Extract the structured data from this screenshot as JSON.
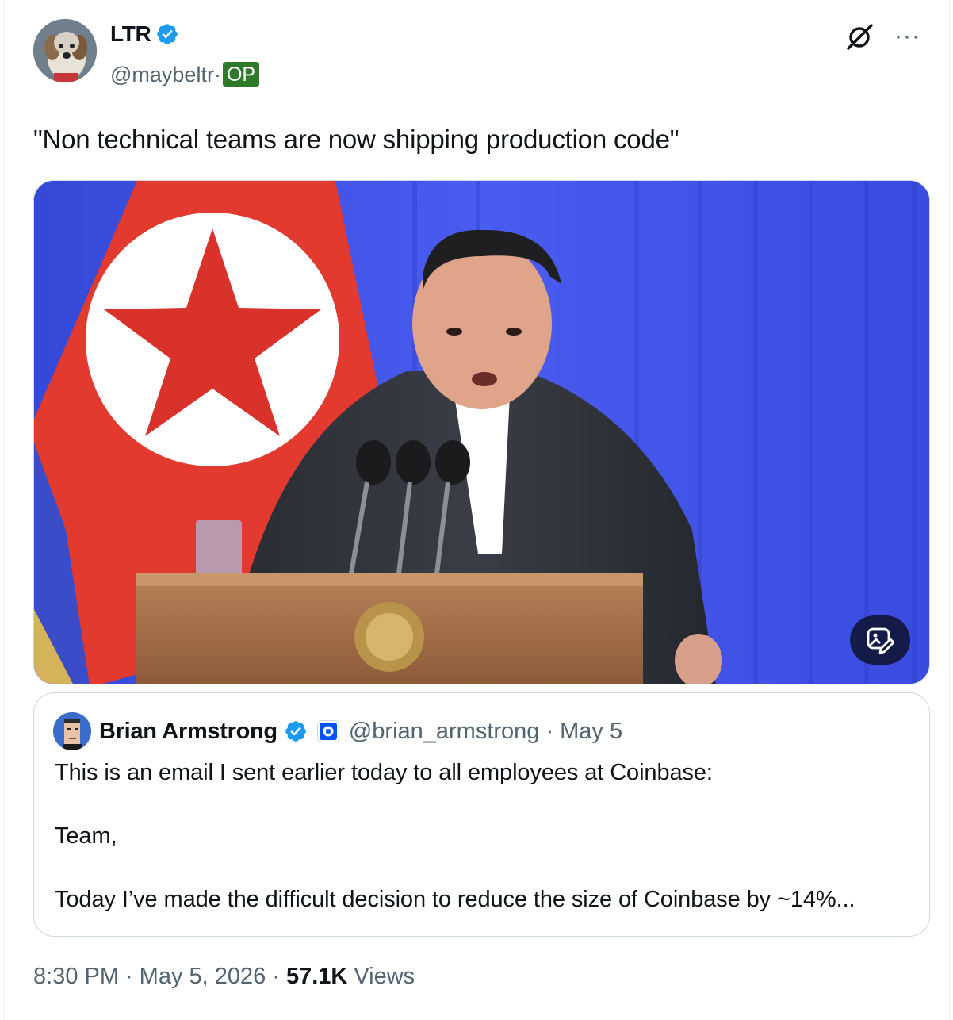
{
  "author": {
    "name": "LTR",
    "handle": "@maybeltr",
    "separator": "·",
    "op_badge": "OP",
    "verified_icon": "verified-badge-icon",
    "avatar_icon": "dog-avatar"
  },
  "actions": {
    "grok_icon": "grok-icon",
    "more_label": "···"
  },
  "tweet": {
    "text": "\"Non technical teams are now shipping production code\""
  },
  "media": {
    "alt_icon": "image-edit-icon"
  },
  "quote": {
    "name": "Brian Armstrong",
    "handle": "@brian_armstrong",
    "separator": "·",
    "date": "May 5",
    "line1": "This is an email I sent earlier today to all employees at Coinbase:",
    "line2": "Team,",
    "line3": "Today I’ve made the difficult decision to reduce the size of Coinbase by ~14%..."
  },
  "meta": {
    "time": "8:30 PM",
    "sep1": "·",
    "date": "May 5, 2026",
    "sep2": "·",
    "views_count": "57.1K",
    "views_label": "Views"
  },
  "colors": {
    "verified": "#1d9bf0",
    "op_badge": "#2f7a2a",
    "coinbase": "#0052ff"
  }
}
